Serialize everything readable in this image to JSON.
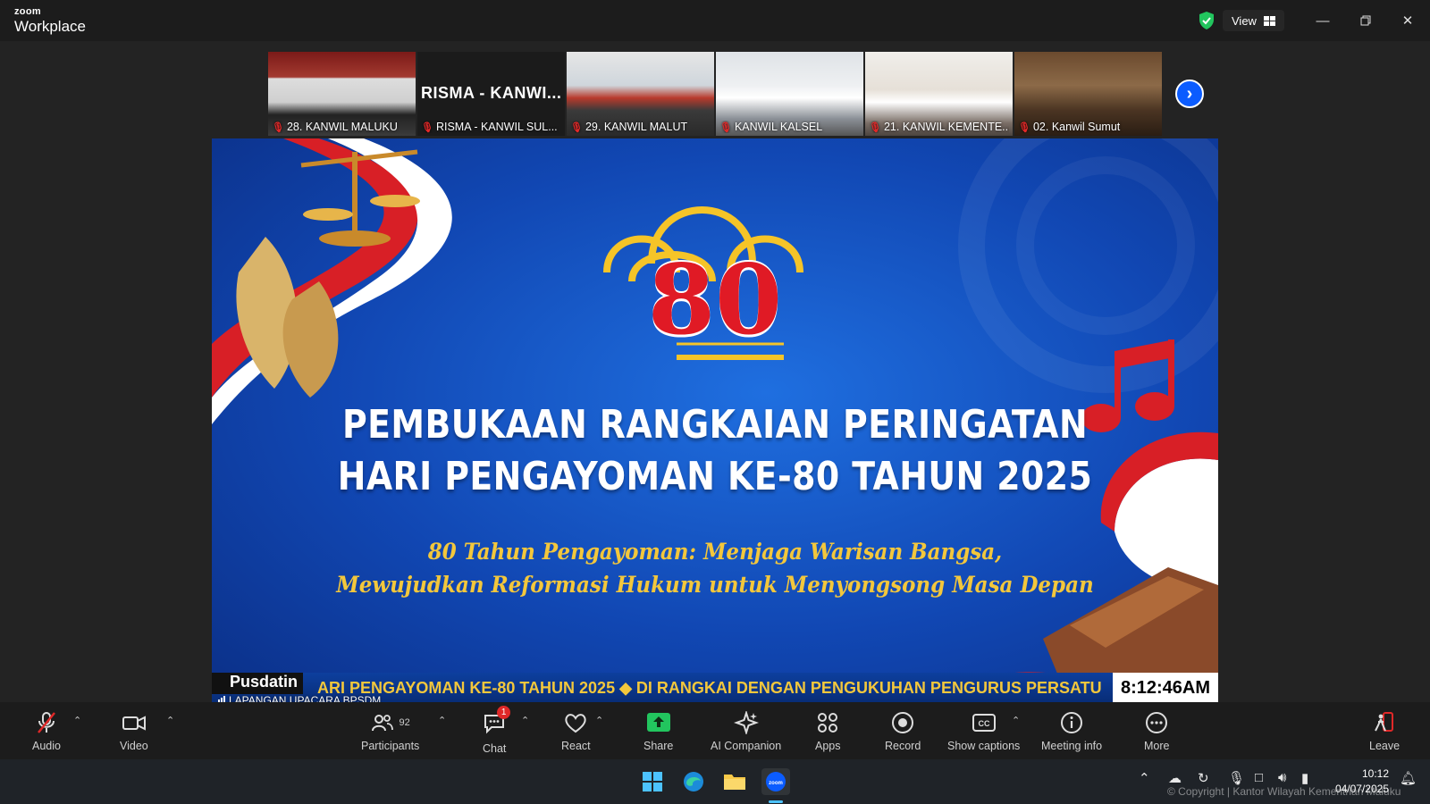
{
  "app": {
    "brand_small": "zoom",
    "brand_name": "Workplace"
  },
  "titlebar": {
    "view_label": "View"
  },
  "thumbnails": [
    {
      "label": "28. KANWIL MALUKU"
    },
    {
      "label": "RISMA - KANWIL SUL...",
      "video_text": "RISMA  -  KANWI..."
    },
    {
      "label": "29. KANWIL MALUT"
    },
    {
      "label": "KANWIL KALSEL"
    },
    {
      "label": "21. KANWIL KEMENTE..."
    },
    {
      "label": "02. Kanwil Sumut"
    }
  ],
  "share": {
    "headline_1": "PEMBUKAAN RANGKAIAN PERINGATAN",
    "headline_2": "HARI PENGAYOMAN KE-80 TAHUN 2025",
    "tagline_1": "80 Tahun Pengayoman: Menjaga Warisan Bangsa,",
    "tagline_2": "Mewujudkan Reformasi Hukum untuk Menyongsong Masa Depan",
    "logo_number": "80",
    "ticker_source": "Pusdatin",
    "ticker_text": "ARI PENGAYOMAN KE-80 TAHUN 2025  ◆  DI RANGKAI DENGAN PENGUKUHAN PENGURUS PERSATU",
    "ticker_time": "8:12:46AM",
    "speaker": "LAPANGAN UPACARA BPSDM"
  },
  "toolbar": {
    "audio": "Audio",
    "video": "Video",
    "participants": "Participants",
    "participants_count": "92",
    "chat": "Chat",
    "chat_badge": "1",
    "react": "React",
    "share": "Share",
    "ai_companion": "AI Companion",
    "apps": "Apps",
    "record": "Record",
    "captions": "Show captions",
    "meeting_info": "Meeting info",
    "more": "More",
    "leave": "Leave"
  },
  "taskbar": {
    "time": "10:12",
    "date": "04/07/2025"
  },
  "copyright": "© Copyright | Kantor Wilayah Kementrian Maluku",
  "colors": {
    "accent": "#0b5cff",
    "share_green": "#22c55e",
    "leave_red": "#e02828",
    "gold": "#f3c73c",
    "mute_red": "#e02828"
  }
}
